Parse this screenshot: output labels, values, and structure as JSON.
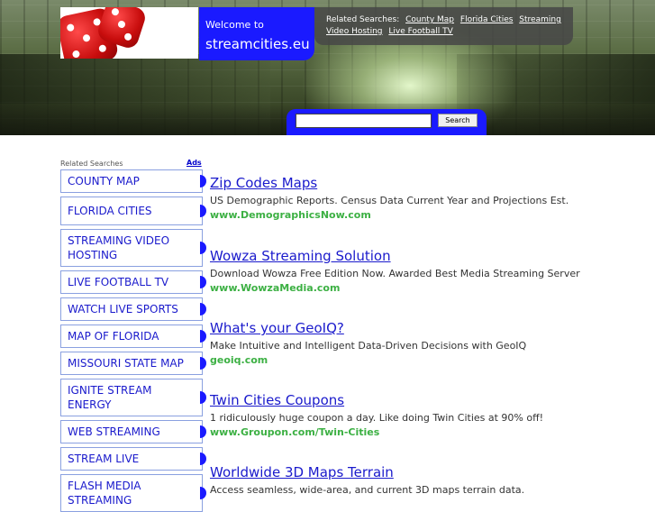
{
  "header": {
    "welcome_prefix": "Welcome to",
    "site_name": "streamcities.eu",
    "related_label": "Related Searches:",
    "related_links": [
      "County Map",
      "Florida Cities",
      "Streaming Video Hosting",
      "Live Football TV"
    ],
    "search_button": "Search",
    "search_placeholder": ""
  },
  "sidebar": {
    "label": "Related Searches",
    "ads_label": "Ads",
    "items": [
      "COUNTY MAP",
      "FLORIDA CITIES",
      "STREAMING VIDEO HOSTING",
      "LIVE FOOTBALL TV",
      "WATCH LIVE SPORTS",
      "MAP OF FLORIDA",
      "MISSOURI STATE MAP",
      "IGNITE STREAM ENERGY",
      "WEB STREAMING",
      "STREAM LIVE",
      "FLASH MEDIA STREAMING"
    ]
  },
  "listings": [
    {
      "title": "Zip Codes Maps",
      "desc": "US Demographic Reports. Census Data Current Year and Projections Est.",
      "url": "www.DemographicsNow.com"
    },
    {
      "title": "Wowza Streaming Solution",
      "desc": "Download Wowza Free Edition Now. Awarded Best Media Streaming Server",
      "url": "www.WowzaMedia.com"
    },
    {
      "title": "What's your GeoIQ?",
      "desc": "Make Intuitive and Intelligent Data-Driven Decisions with GeoIQ",
      "url": "geoiq.com"
    },
    {
      "title": "Twin Cities Coupons",
      "desc": "1 ridiculously huge coupon a day. Like doing Twin Cities at 90% off!",
      "url": "www.Groupon.com/Twin-Cities"
    },
    {
      "title": "Worldwide 3D Maps Terrain",
      "desc": "Access seamless, wide-area, and current 3D maps terrain data.",
      "url": ""
    }
  ],
  "colors": {
    "accent": "#1a1aff",
    "link": "#1a1acc",
    "url": "#3cb043"
  }
}
